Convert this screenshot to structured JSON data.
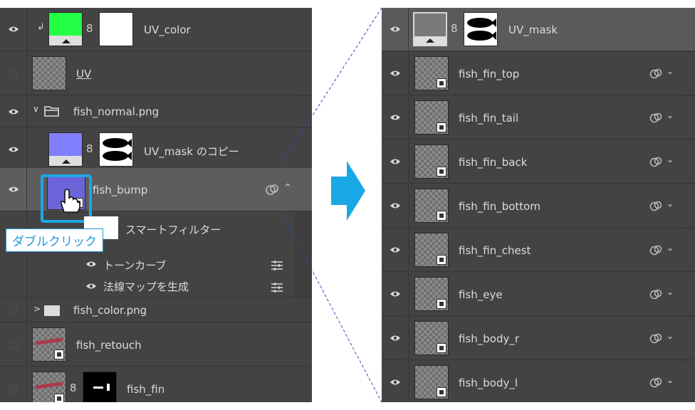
{
  "left_panel": {
    "layers": [
      {
        "name": "UV_color",
        "visible": true
      },
      {
        "name": "UV",
        "visible": false
      },
      {
        "name": "fish_normal.png",
        "visible": true
      },
      {
        "name": "UV_mask のコピー",
        "visible": true
      },
      {
        "name": "fish_bump",
        "visible": true
      },
      {
        "name": "スマートフィルター"
      },
      {
        "name": "トーンカーブ"
      },
      {
        "name": "法線マップを生成"
      },
      {
        "name": "fish_color.png",
        "visible": false
      },
      {
        "name": "fish_retouch",
        "visible": false
      },
      {
        "name": "fish_fin",
        "visible": false
      }
    ],
    "callout": "ダブルクリック"
  },
  "right_panel": {
    "layers": [
      {
        "name": "UV_mask"
      },
      {
        "name": "fish_fin_top"
      },
      {
        "name": "fish_fin_tail"
      },
      {
        "name": "fish_fin_back"
      },
      {
        "name": "fish_fin_bottom"
      },
      {
        "name": "fish_fin_chest"
      },
      {
        "name": "fish_eye"
      },
      {
        "name": "fish_body_r"
      },
      {
        "name": "fish_body_l"
      }
    ]
  },
  "colors": {
    "panel_bg": "#434343",
    "selected_bg": "#5d5d5d",
    "accent": "#19a8e6",
    "uv_color_fill": "#22ff44",
    "normal_map_fill": "#7f7fff"
  }
}
